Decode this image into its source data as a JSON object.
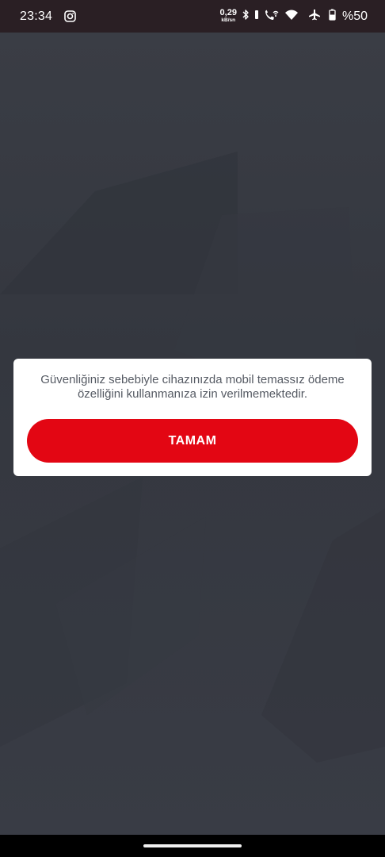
{
  "status_bar": {
    "time": "23:34",
    "net_speed_value": "0,29",
    "net_speed_unit": "kB/sn",
    "battery_percent": "%50",
    "icons": [
      "instagram-icon",
      "bluetooth-icon",
      "vibrate-icon",
      "wifi-calling-icon",
      "wifi-icon",
      "airplane-mode-icon",
      "battery-icon"
    ]
  },
  "dialog": {
    "message": "Güvenliğiniz sebebiyle cihazınızda mobil temassız ödeme özelliğini kullanmanıza izin verilmemektedir.",
    "button_label": "TAMAM",
    "button_color": "#e30613"
  },
  "theme": {
    "background": "#2e3038",
    "status_bar_bg": "#2a1f24"
  }
}
